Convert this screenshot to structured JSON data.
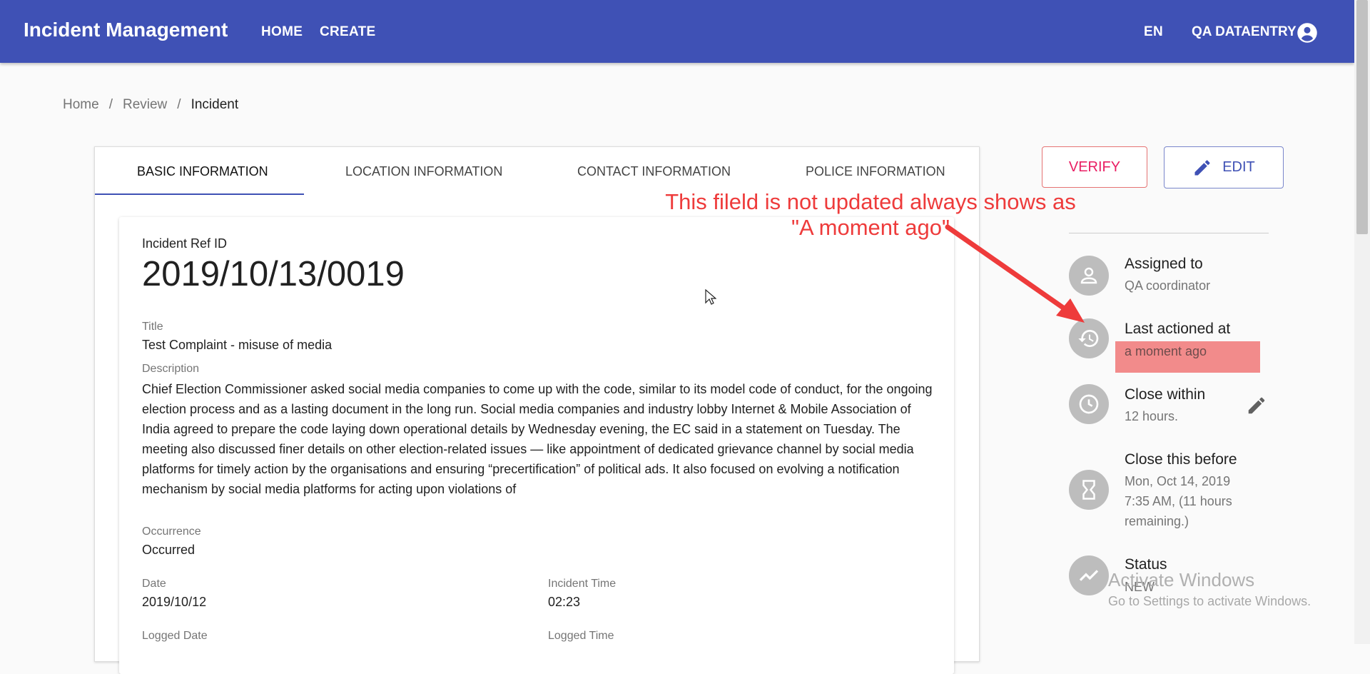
{
  "header": {
    "title": "Incident Management",
    "nav": [
      "HOME",
      "CREATE"
    ],
    "language": "EN",
    "user": "QA DATAENTRY"
  },
  "breadcrumb": [
    "Home",
    "Review",
    "Incident"
  ],
  "tabs": [
    "BASIC INFORMATION",
    "LOCATION INFORMATION",
    "CONTACT INFORMATION",
    "POLICE INFORMATION"
  ],
  "incident": {
    "ref_label": "Incident Ref ID",
    "ref_id": "2019/10/13/0019",
    "title_label": "Title",
    "title": "Test Complaint - misuse of media",
    "description_label": "Description",
    "description": "Chief Election Commissioner asked social media companies to come up with the code, similar to its model code of conduct, for the ongoing election process and as a lasting document in the long run. Social media companies and industry lobby Internet & Mobile Association of India agreed to prepare the code laying down operational details by Wednesday evening, the EC said in a statement on Tuesday. The meeting also discussed finer details on other election-related issues — like appointment of dedicated grievance channel by social media platforms for timely action by the organisations and ensuring “precertification” of political ads. It also focused on evolving a notification mechanism by social media platforms for acting upon violations of",
    "occurrence_label": "Occurrence",
    "occurrence": "Occurred",
    "date_label": "Date",
    "date": "2019/10/12",
    "time_label": "Incident Time",
    "time": "02:23",
    "logged_date_label": "Logged Date",
    "logged_time_label": "Logged Time"
  },
  "actions": {
    "verify": "VERIFY",
    "edit": "EDIT"
  },
  "sidebar": {
    "assigned_title": "Assigned to",
    "assigned_value": "QA coordinator",
    "last_title": "Last actioned at",
    "last_value": "a moment ago",
    "close_within_title": "Close within",
    "close_within_value": "12 hours.",
    "close_before_title": "Close this before",
    "close_before_lines": [
      "Mon, Oct 14, 2019",
      "7:35 AM, (11 hours",
      "remaining.)"
    ],
    "status_title": "Status",
    "status_value": "NEW"
  },
  "annotation": {
    "line1": "This fileld is not updated always shows as",
    "line2": "\"A moment ago\"",
    "color": "#ee3b3b"
  },
  "watermark": {
    "line1": "Activate Windows",
    "line2": "Go to Settings to activate Windows."
  },
  "colors": {
    "primary": "#3f51b5",
    "verify": "#e91e63",
    "highlight": "#f28b8b"
  }
}
